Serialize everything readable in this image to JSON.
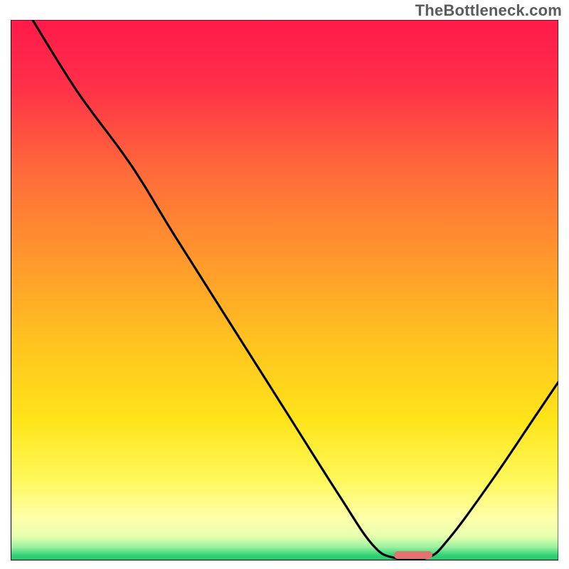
{
  "attribution": "TheBottleneck.com",
  "colors": {
    "gradient_stops": [
      {
        "offset": 0.0,
        "color": "#ff1a4b"
      },
      {
        "offset": 0.12,
        "color": "#ff2f49"
      },
      {
        "offset": 0.28,
        "color": "#ff6a3a"
      },
      {
        "offset": 0.45,
        "color": "#ff9a2c"
      },
      {
        "offset": 0.6,
        "color": "#ffc41f"
      },
      {
        "offset": 0.74,
        "color": "#ffe41a"
      },
      {
        "offset": 0.85,
        "color": "#fff85a"
      },
      {
        "offset": 0.92,
        "color": "#ffffa8"
      },
      {
        "offset": 0.955,
        "color": "#e8ffb0"
      },
      {
        "offset": 0.975,
        "color": "#9cf2a0"
      },
      {
        "offset": 0.99,
        "color": "#34d277"
      },
      {
        "offset": 1.0,
        "color": "#1ec96b"
      }
    ],
    "curve": "#000000",
    "marker_fill": "#e2736f",
    "marker_stroke": "#c7524e",
    "axis": "#000000"
  },
  "chart_data": {
    "type": "line",
    "title": "",
    "xlabel": "",
    "ylabel": "",
    "xlim": [
      0,
      100
    ],
    "ylim": [
      0,
      100
    ],
    "grid": false,
    "series": [
      {
        "name": "bottleneck-curve",
        "points": [
          {
            "x": 4,
            "y": 100
          },
          {
            "x": 12,
            "y": 87
          },
          {
            "x": 20,
            "y": 76
          },
          {
            "x": 24,
            "y": 70
          },
          {
            "x": 30,
            "y": 60
          },
          {
            "x": 40,
            "y": 44
          },
          {
            "x": 50,
            "y": 28
          },
          {
            "x": 60,
            "y": 12
          },
          {
            "x": 66,
            "y": 3
          },
          {
            "x": 70,
            "y": 0.5
          },
          {
            "x": 76,
            "y": 0.5
          },
          {
            "x": 80,
            "y": 4
          },
          {
            "x": 88,
            "y": 15
          },
          {
            "x": 96,
            "y": 27
          },
          {
            "x": 100,
            "y": 33
          }
        ]
      }
    ],
    "marker": {
      "x_start": 70,
      "x_end": 77,
      "y": 1.0
    }
  }
}
